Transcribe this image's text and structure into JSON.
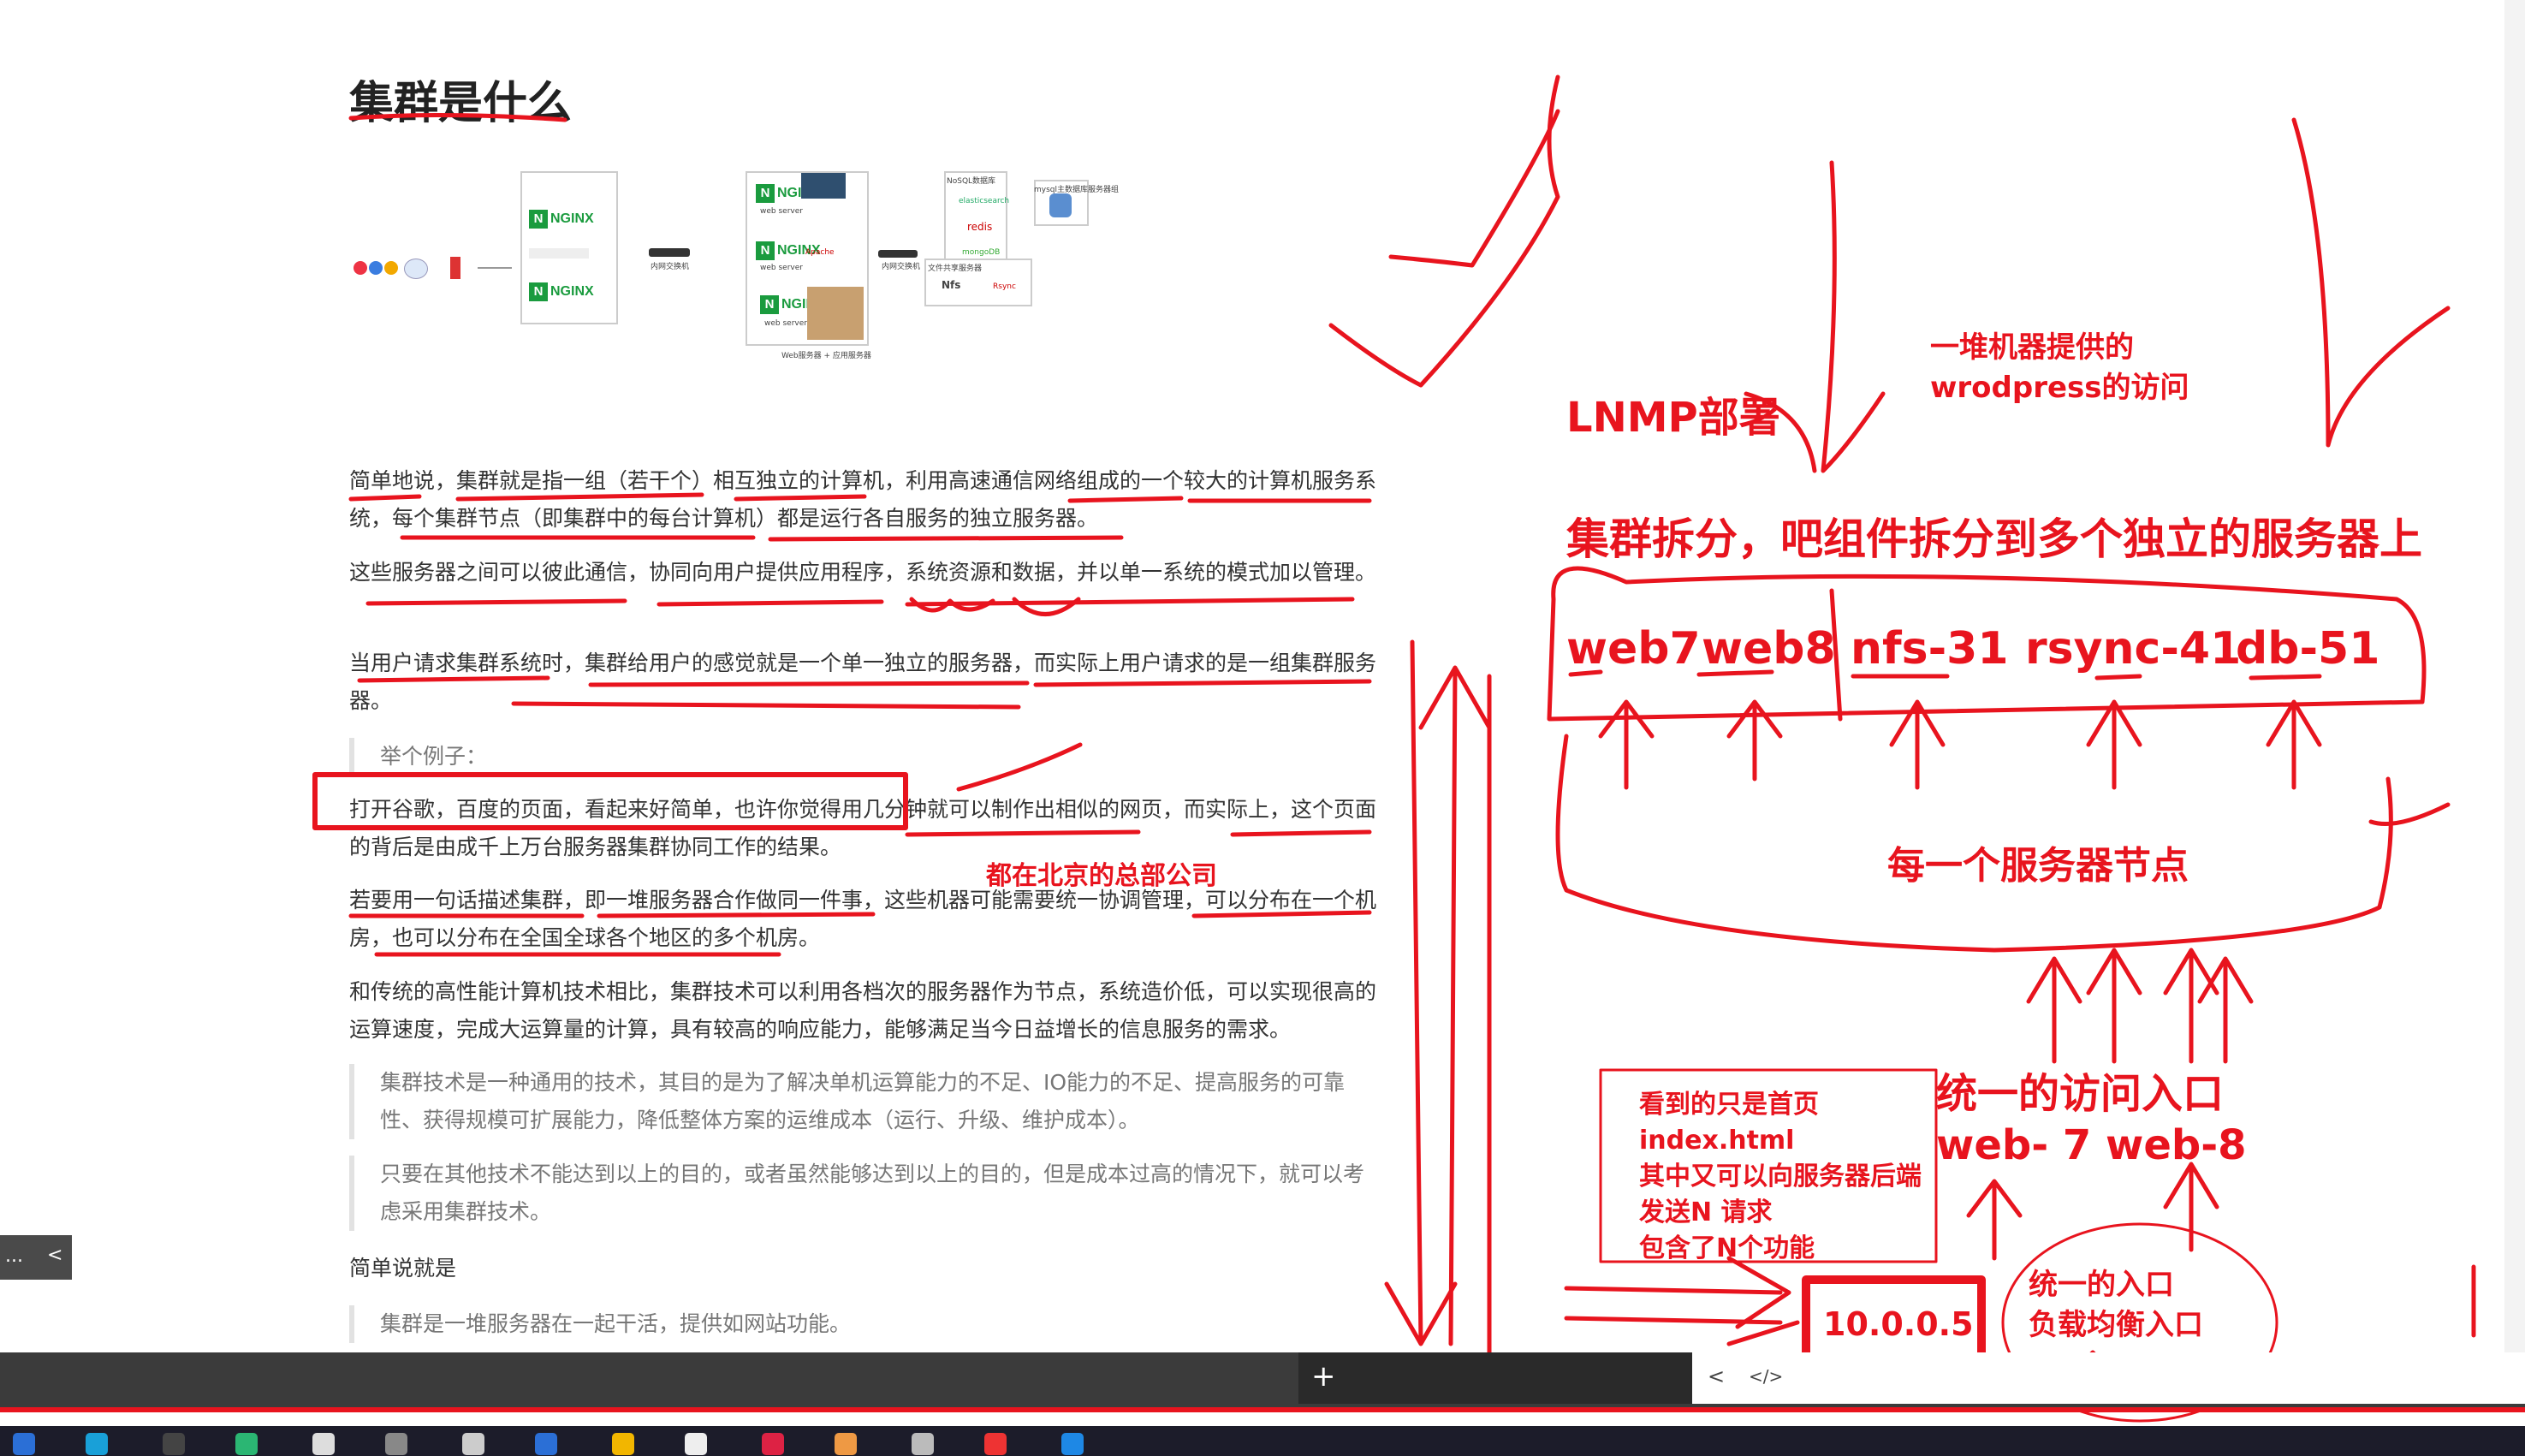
{
  "title": "集群是什么",
  "diagram": {
    "nginx_label": "NGINX",
    "web_server": "web server",
    "apache": "Apache",
    "elasticsearch": "elasticsearch",
    "redis": "redis",
    "mongodb": "mongoDB",
    "nfs": "Nfs",
    "rsync": "Rsync",
    "layer_web": "Web服务器 + 应用服务器",
    "nosql_title": "NoSQL数据库",
    "mysql_title": "mysql主数据库服务器组",
    "storage_title": "文件共享服务器",
    "intranet_switch": "内网交换机"
  },
  "paragraphs": {
    "p1": "简单地说，集群就是指一组（若干个）相互独立的计算机，利用高速通信网络组成的一个较大的计算机服务系统，每个集群节点（即集群中的每台计算机）都是运行各自服务的独立服务器。",
    "p2": "这些服务器之间可以彼此通信，协同向用户提供应用程序，系统资源和数据，并以单一系统的模式加以管理。",
    "p3": "当用户请求集群系统时，集群给用户的感觉就是一个单一独立的服务器，而实际上用户请求的是一组集群服务器。",
    "q1": "举个例子：",
    "p4": "打开谷歌，百度的页面，看起来好简单，也许你觉得用几分钟就可以制作出相似的网页，而实际上，这个页面的背后是由成千上万台服务器集群协同工作的结果。",
    "p5": "若要用一句话描述集群，即一堆服务器合作做同一件事，这些机器可能需要统一协调管理，可以分布在一个机房，也可以分布在全国全球各个地区的多个机房。",
    "p6": "和传统的高性能计算机技术相比，集群技术可以利用各档次的服务器作为节点，系统造价低，可以实现很高的运算速度，完成大运算量的计算，具有较高的响应能力，能够满足当今日益增长的信息服务的需求。",
    "q2": "集群技术是一种通用的技术，其目的是为了解决单机运算能力的不足、IO能力的不足、提高服务的可靠性、获得规模可扩展能力，降低整体方案的运维成本（运行、升级、维护成本）。",
    "q3": "只要在其他技术不能达到以上的目的，或者虽然能够达到以上的目的，但是成本过高的情况下，就可以考虑采用集群技术。",
    "p7": "简单说就是",
    "q4": "集群是一堆服务器在一起干活，提供如网站功能。"
  },
  "annotations": {
    "lnmp": "LNMP部署",
    "pile_provide_1": "一堆机器提供的",
    "pile_provide_2": "wrodpress的访问",
    "split": "集群拆分，吧组件拆分到多个独立的服务器上",
    "web7": "web7",
    "web8": "web8",
    "nfs": "nfs-31",
    "rsync": "rsync-41",
    "db": "db-51",
    "each_node": "每一个服务器节点",
    "beijing": "都在北京的总部公司",
    "unified_entry": "统一的访问入口",
    "web_pair": "web- 7  web-8",
    "box_line1": "看到的只是首页",
    "box_line2": "index.html",
    "box_line3": "其中又可以向服务器后端",
    "box_line4": "发送N 请求",
    "box_line5": "包含了N个功能",
    "ip": "10.0.0.5",
    "entry1": "统一的入口",
    "entry2": "负载均衡入口"
  },
  "ui": {
    "plus": "+",
    "left_btn": "...",
    "chevron_left": "<",
    "code_icon": "</>"
  },
  "colors": {
    "annotation_red": "#e8141e"
  }
}
